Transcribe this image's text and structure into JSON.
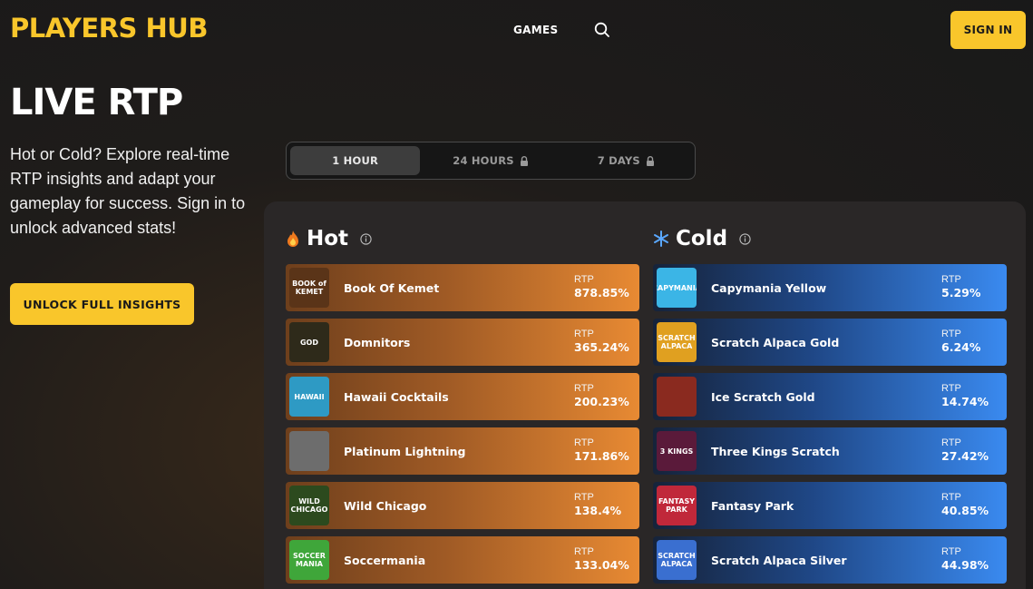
{
  "header": {
    "logo": "PLAYERS HUB",
    "nav_games": "GAMES",
    "signin_label": "SIGN IN"
  },
  "hero": {
    "title": "LIVE RTP",
    "intro": "Hot or Cold? Explore real-time RTP insights and adapt your gameplay for success. Sign in to unlock advanced stats!",
    "unlock_label": "UNLOCK FULL INSIGHTS"
  },
  "tabs": [
    {
      "label": "1 HOUR",
      "active": true,
      "locked": false
    },
    {
      "label": "24 HOURS",
      "active": false,
      "locked": true
    },
    {
      "label": "7 DAYS",
      "active": false,
      "locked": true
    }
  ],
  "hot": {
    "title": "Hot",
    "rtp_label": "RTP",
    "games": [
      {
        "name": "Book Of Kemet",
        "rtp": "878.85%",
        "thumb_text": "BOOK of KEMET",
        "thumb_color": "#5a3418"
      },
      {
        "name": "Domnitors",
        "rtp": "365.24%",
        "thumb_text": "GOD",
        "thumb_color": "#2e2a1a"
      },
      {
        "name": "Hawaii Cocktails",
        "rtp": "200.23%",
        "thumb_text": "HAWAII",
        "thumb_color": "#2e9ac4"
      },
      {
        "name": "Platinum Lightning",
        "rtp": "171.86%",
        "thumb_text": "",
        "thumb_color": "#6d6d6d"
      },
      {
        "name": "Wild Chicago",
        "rtp": "138.4%",
        "thumb_text": "WILD CHICAGO",
        "thumb_color": "#2c4a1e"
      },
      {
        "name": "Soccermania",
        "rtp": "133.04%",
        "thumb_text": "SOCCER MANIA",
        "thumb_color": "#3fa63a"
      }
    ]
  },
  "cold": {
    "title": "Cold",
    "rtp_label": "RTP",
    "games": [
      {
        "name": "Capymania Yellow",
        "rtp": "5.29%",
        "thumb_text": "CAPYMANIA",
        "thumb_color": "#3bb5e6"
      },
      {
        "name": "Scratch Alpaca Gold",
        "rtp": "6.24%",
        "thumb_text": "SCRATCH ALPACA",
        "thumb_color": "#e0a020"
      },
      {
        "name": "Ice Scratch Gold",
        "rtp": "14.74%",
        "thumb_text": "",
        "thumb_color": "#8a2a1f"
      },
      {
        "name": "Three Kings Scratch",
        "rtp": "27.42%",
        "thumb_text": "3 KINGS",
        "thumb_color": "#5a1a3a"
      },
      {
        "name": "Fantasy Park",
        "rtp": "40.85%",
        "thumb_text": "FANTASY PARK",
        "thumb_color": "#c0283a"
      },
      {
        "name": "Scratch Alpaca Silver",
        "rtp": "44.98%",
        "thumb_text": "SCRATCH ALPACA",
        "thumb_color": "#3a6fd0"
      }
    ]
  },
  "colors": {
    "accent": "#f9c62b",
    "hot": "#e88a33",
    "cold": "#3a8af0"
  }
}
